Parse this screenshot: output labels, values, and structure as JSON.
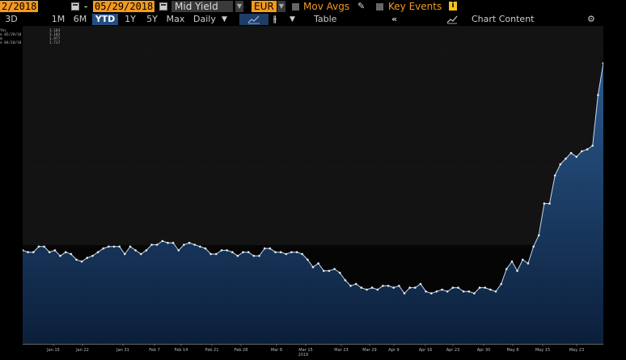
{
  "toolbar": {
    "start_date": "2/2018",
    "separator": "-",
    "end_date": "05/29/2018",
    "field": "Mid Yield",
    "currency": "EUR",
    "mov_avgs": "Mov Avgs",
    "key_events": "Key Events",
    "info_icon": "i"
  },
  "period_tabs": [
    "3D",
    "1M",
    "6M",
    "YTD",
    "1Y",
    "5Y",
    "Max"
  ],
  "active_tab": "YTD",
  "frequency": "Daily",
  "frequency_arrow": "▼",
  "chart_type_arrow": "▼",
  "table_label": "Table",
  "collapse_glyph": "«",
  "chart_content_label": "Chart Content",
  "gear_glyph": "⚙",
  "legend": [
    {
      "label": "Yhs",
      "value": "3.103"
    },
    {
      "label": "e 05/29/18",
      "value": "3.102"
    },
    {
      "label": "m",
      "value": "1.977"
    },
    {
      "label": "e 04/18/18",
      "value": "1.717"
    }
  ],
  "colors": {
    "accent_orange": "#f39a1e",
    "tab_active": "#254e80",
    "series_line": "#c8d8ec",
    "series_fill_top": "#2b5a8f",
    "series_fill_bottom": "#0b1f3a"
  },
  "chart_data": {
    "type": "area",
    "title": "",
    "xlabel": "",
    "ylabel": "",
    "x_tick_labels": [
      "Jan 15",
      "Jan 22",
      "Jan 31",
      "Feb 7",
      "Feb 14",
      "Feb 21",
      "Feb 28",
      "Mar 8",
      "Mar 15",
      "Mar 23",
      "Mar 29",
      "Apr 9",
      "Apr 16",
      "Apr 23",
      "Apr 30",
      "May 8",
      "May 15",
      "May 23"
    ],
    "x_year_label": "2018",
    "ylim": [
      1.6,
      3.3
    ],
    "series": [
      {
        "values": [
          2.1,
          2.09,
          2.09,
          2.12,
          2.12,
          2.09,
          2.1,
          2.07,
          2.09,
          2.08,
          2.05,
          2.04,
          2.06,
          2.07,
          2.09,
          2.11,
          2.12,
          2.12,
          2.12,
          2.08,
          2.12,
          2.1,
          2.08,
          2.1,
          2.13,
          2.13,
          2.15,
          2.14,
          2.14,
          2.1,
          2.13,
          2.14,
          2.13,
          2.12,
          2.11,
          2.08,
          2.08,
          2.1,
          2.1,
          2.09,
          2.07,
          2.09,
          2.09,
          2.07,
          2.07,
          2.11,
          2.11,
          2.09,
          2.09,
          2.08,
          2.09,
          2.09,
          2.08,
          2.05,
          2.01,
          2.03,
          1.99,
          1.99,
          2.0,
          1.98,
          1.94,
          1.91,
          1.92,
          1.9,
          1.89,
          1.9,
          1.89,
          1.91,
          1.91,
          1.9,
          1.91,
          1.87,
          1.9,
          1.9,
          1.92,
          1.88,
          1.87,
          1.88,
          1.89,
          1.88,
          1.9,
          1.9,
          1.88,
          1.88,
          1.87,
          1.9,
          1.9,
          1.89,
          1.88,
          1.92,
          2.0,
          2.04,
          1.99,
          2.05,
          2.03,
          2.12,
          2.18,
          2.35,
          2.35,
          2.5,
          2.56,
          2.59,
          2.62,
          2.6,
          2.63,
          2.64,
          2.66,
          2.93,
          3.1
        ]
      }
    ]
  }
}
